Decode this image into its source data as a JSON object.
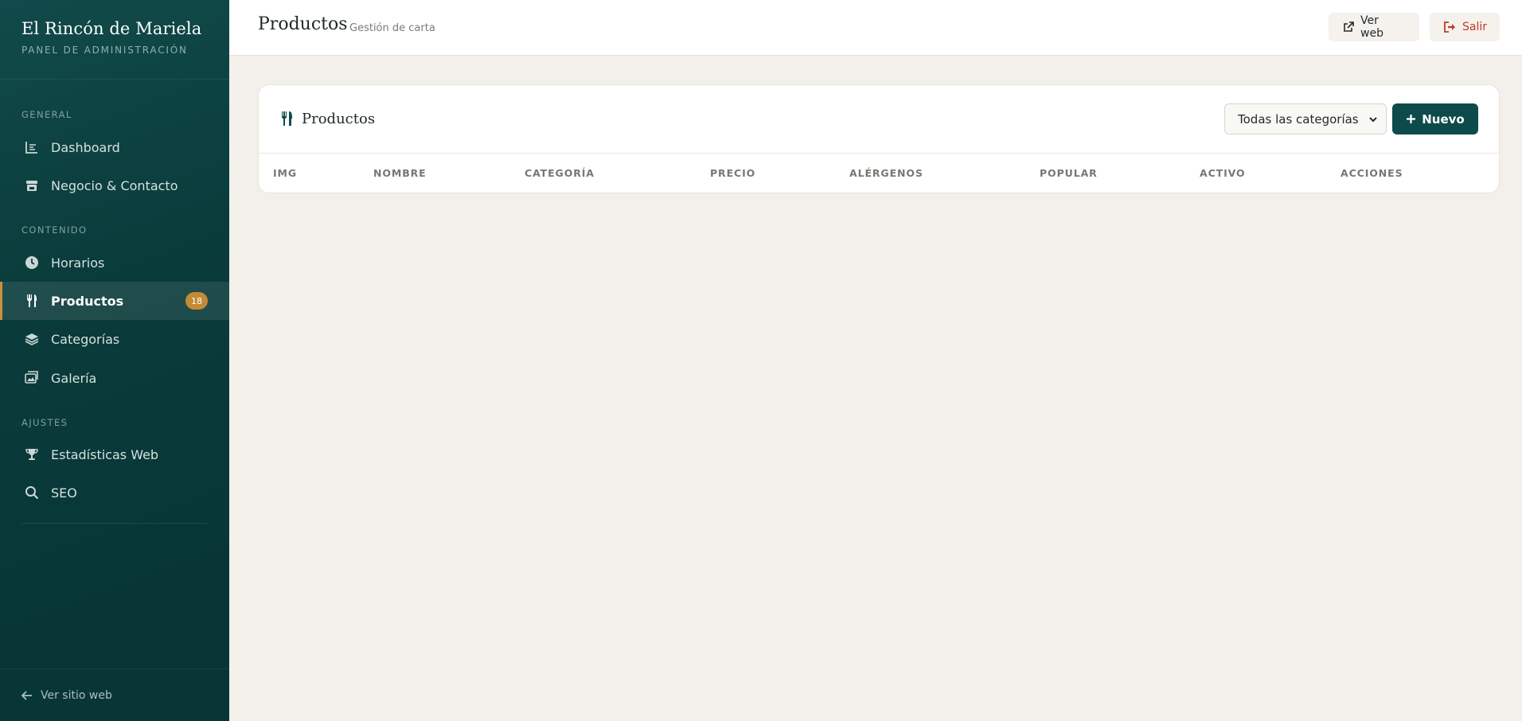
{
  "sidebar": {
    "brand_title": "El Rincón de Mariela",
    "brand_sub": "PANEL DE ADMINISTRACIÓN",
    "sections": {
      "general": "GENERAL",
      "contenido": "CONTENIDO",
      "ajustes": "AJUSTES"
    },
    "items": [
      {
        "label": "Dashboard",
        "icon": "chart-icon"
      },
      {
        "label": "Negocio & Contacto",
        "icon": "store-icon"
      },
      {
        "label": "Horarios",
        "icon": "clock-icon"
      },
      {
        "label": "Productos",
        "icon": "utensils-icon",
        "badge": "18",
        "active": true
      },
      {
        "label": "Categorías",
        "icon": "layers-icon"
      },
      {
        "label": "Galería",
        "icon": "images-icon"
      },
      {
        "label": "Estadísticas Web",
        "icon": "trophy-icon"
      },
      {
        "label": "SEO",
        "icon": "search-icon"
      }
    ],
    "footer_label": "Ver sitio web"
  },
  "header": {
    "title": "Productos",
    "subtitle": "Gestión de carta",
    "view_web_label": "Ver web",
    "logout_label": "Salir"
  },
  "card": {
    "title": "Productos",
    "category_filter": "Todas las categorías",
    "new_label": "Nuevo",
    "columns": [
      "IMG",
      "NOMBRE",
      "CATEGORÍA",
      "PRECIO",
      "ALÉRGENOS",
      "POPULAR",
      "ACTIVO",
      "ACCIONES"
    ]
  },
  "colors": {
    "sidebar_bg": "#0a3b3b",
    "accent": "#c48a36",
    "primary_button": "#0d4b4b",
    "logout": "#c0392b",
    "page_bg": "#f3f0eb"
  }
}
